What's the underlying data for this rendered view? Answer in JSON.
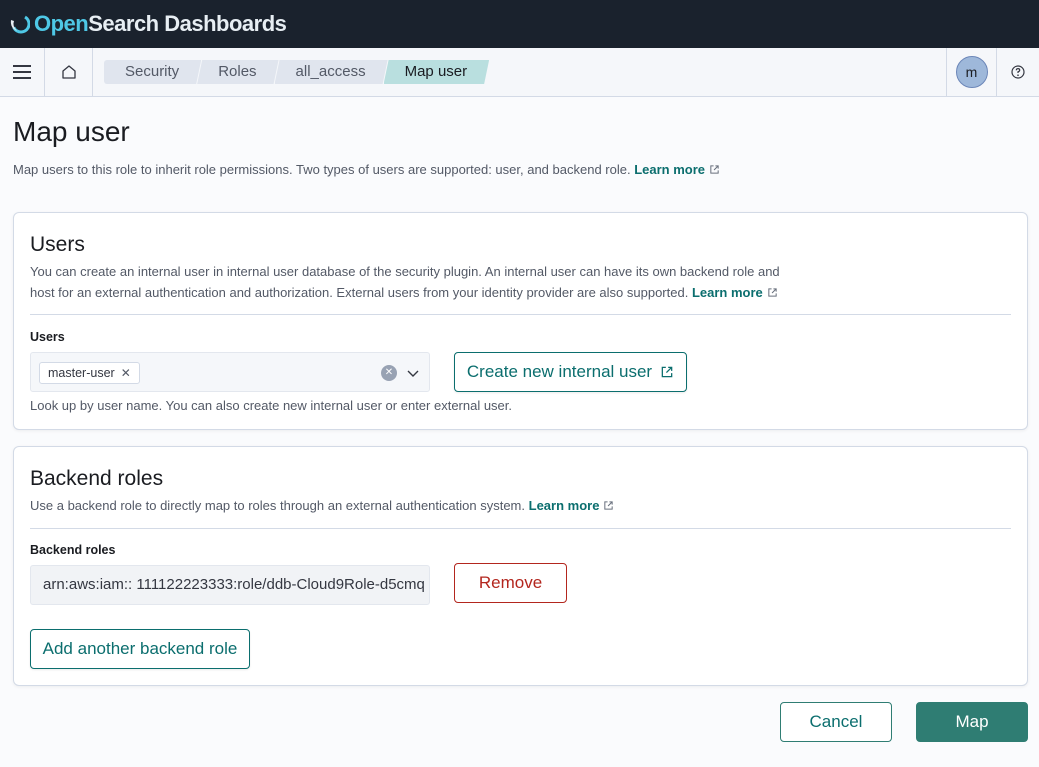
{
  "app": {
    "logo_part1": "Open",
    "logo_part2": "Search Dashboards"
  },
  "breadcrumbs": [
    "Security",
    "Roles",
    "all_access",
    "Map user"
  ],
  "user_avatar": "m",
  "page": {
    "title": "Map user",
    "description": "Map users to this role to inherit role permissions. Two types of users are supported: user, and backend role.",
    "learn_more": "Learn more"
  },
  "users_panel": {
    "title": "Users",
    "description_line1": "You can create an internal user in internal user database of the security plugin. An internal user can have its own backend role and",
    "description_line2": "host for an external authentication and authorization. External users from your identity provider are also supported.",
    "learn_more": "Learn more",
    "field_label": "Users",
    "selected_user": "master-user",
    "create_button": "Create new internal user",
    "help_text": "Look up by user name. You can also create new internal user or enter external user."
  },
  "backend_panel": {
    "title": "Backend roles",
    "description": "Use a backend role to directly map to roles through an external authentication system.",
    "learn_more": "Learn more",
    "field_label": "Backend roles",
    "role_value": "arn:aws:iam:: 111122223333:role/ddb-Cloud9Role-d5cmq",
    "remove_button": "Remove",
    "add_button": "Add another backend role"
  },
  "footer": {
    "cancel": "Cancel",
    "map": "Map"
  },
  "colors": {
    "header_bg": "#1a222d",
    "accent": "#0b6e6e",
    "primary_button": "#2f7d73",
    "danger": "#b3261e",
    "active_crumb": "#b9dfdf"
  }
}
